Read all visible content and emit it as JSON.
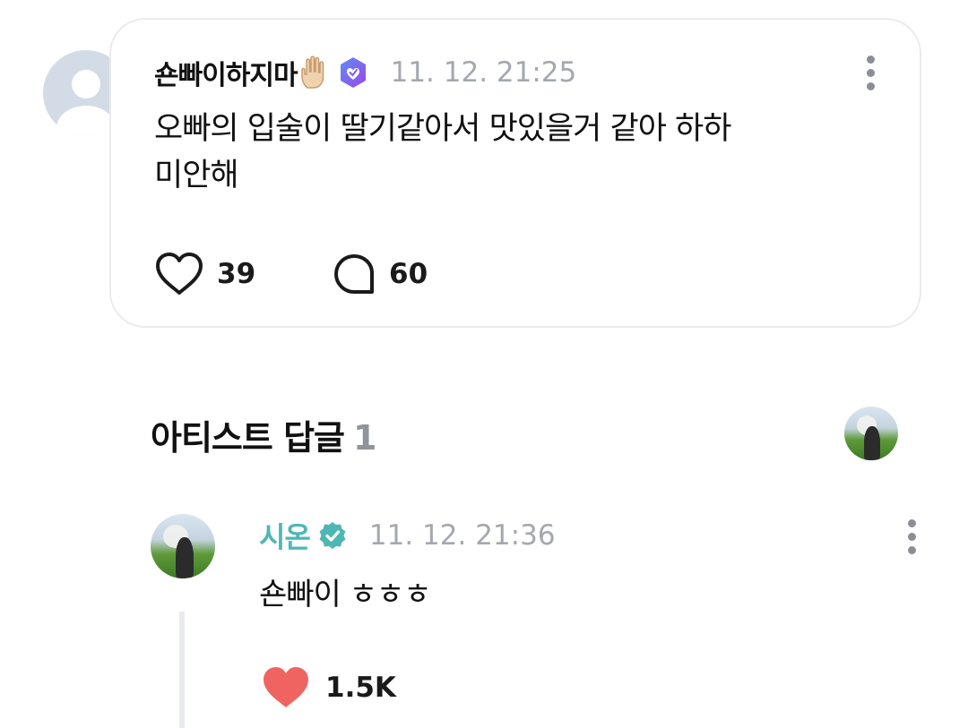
{
  "post": {
    "author": "숀빠이하지마",
    "time": "11. 12. 21:25",
    "body": "오빠의 입술이 딸기같아서 맛있을거 같아 하하\n미안해",
    "likes": "39",
    "comments": "60"
  },
  "artist_replies": {
    "title": "아티스트 답글",
    "count": "1"
  },
  "reply": {
    "author": "시온",
    "time": "11. 12. 21:36",
    "body": "숀빠이 ㅎㅎㅎ",
    "likes": "1.5K"
  },
  "colors": {
    "artist_name": "#4fb7b3",
    "liked_heart": "#ef6461",
    "fan_badge": "#7b5cf0",
    "artist_badge": "#4fb7b3"
  },
  "icons": [
    "raised-hand-icon",
    "fan-badge-icon",
    "more-icon",
    "heart-outline-icon",
    "comment-icon",
    "verified-badge-icon",
    "heart-filled-icon"
  ]
}
